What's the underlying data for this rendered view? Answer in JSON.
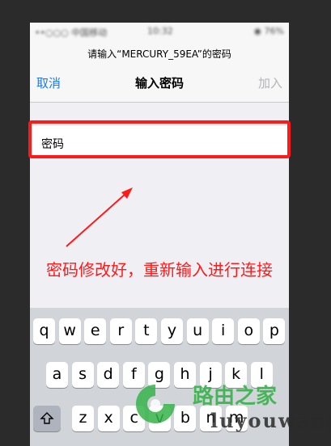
{
  "statusbar": {
    "carrier": "••○○○ 中国移动",
    "time": "10:32",
    "right": "◉ 76%"
  },
  "dialog": {
    "prompt": "请输入“MERCURY_59EA”的密码",
    "cancel": "取消",
    "title": "输入密码",
    "join": "加入"
  },
  "password_field": {
    "label": "密码"
  },
  "annotation": {
    "text": "密码修改好，重新输入进行连接"
  },
  "keyboard": {
    "row1": [
      "q",
      "w",
      "e",
      "r",
      "t",
      "y",
      "u",
      "i",
      "o",
      "p"
    ],
    "row2": [
      "a",
      "s",
      "d",
      "f",
      "g",
      "h",
      "j",
      "k",
      "l"
    ],
    "row3": [
      "z",
      "x",
      "c",
      "v",
      "b",
      "n",
      "m"
    ]
  },
  "watermark": {
    "line1": "路由之家",
    "line2": "luyouwang"
  },
  "colors": {
    "accent": "#1d7ae0",
    "annotation": "#ff1a1a",
    "watermark_green": "#36b34a"
  }
}
